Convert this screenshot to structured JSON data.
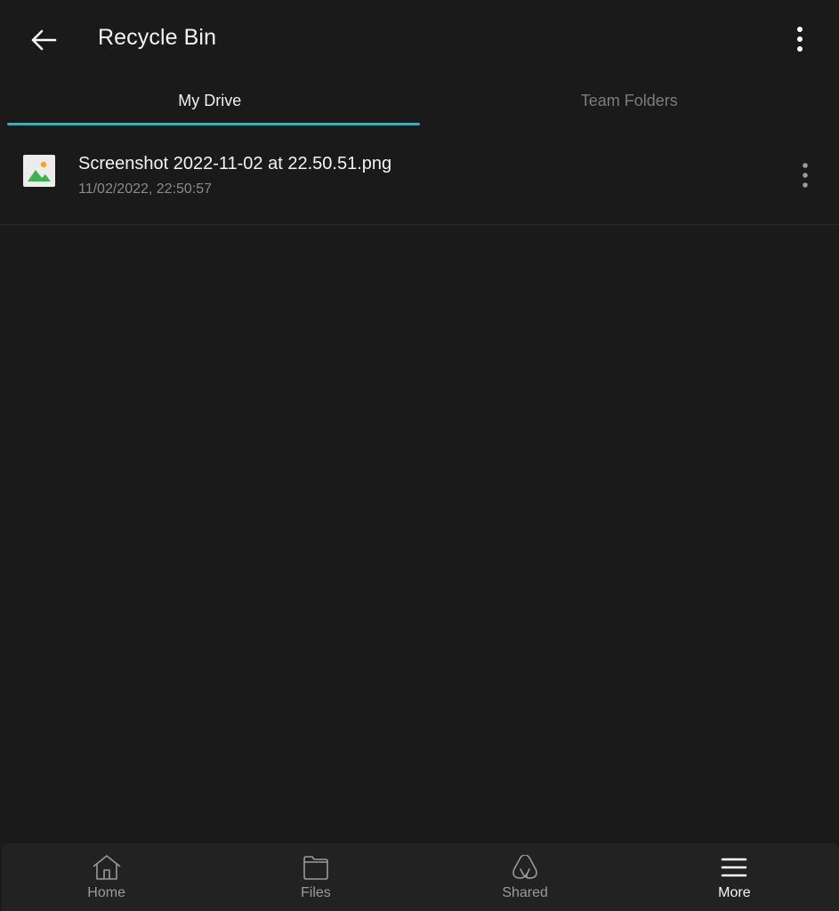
{
  "header": {
    "title": "Recycle Bin",
    "back_icon": "arrow-left-icon",
    "overflow_icon": "more-vertical-icon"
  },
  "tabs": [
    {
      "label": "My Drive",
      "active": true
    },
    {
      "label": "Team Folders",
      "active": false
    }
  ],
  "colors": {
    "accent": "#29b6c4",
    "background": "#1a1a1a",
    "nav_background": "#222222",
    "image_icon_green": "#3cb44b",
    "image_icon_sun": "#f5a623"
  },
  "files": [
    {
      "name": "Screenshot 2022-11-02 at 22.50.51.png",
      "deleted_at": "11/02/2022, 22:50:57",
      "icon": "image-file-icon"
    }
  ],
  "bottom_nav": [
    {
      "label": "Home",
      "icon": "home-icon",
      "active": false
    },
    {
      "label": "Files",
      "icon": "folder-icon",
      "active": false
    },
    {
      "label": "Shared",
      "icon": "shared-icon",
      "active": false
    },
    {
      "label": "More",
      "icon": "menu-icon",
      "active": true
    }
  ]
}
